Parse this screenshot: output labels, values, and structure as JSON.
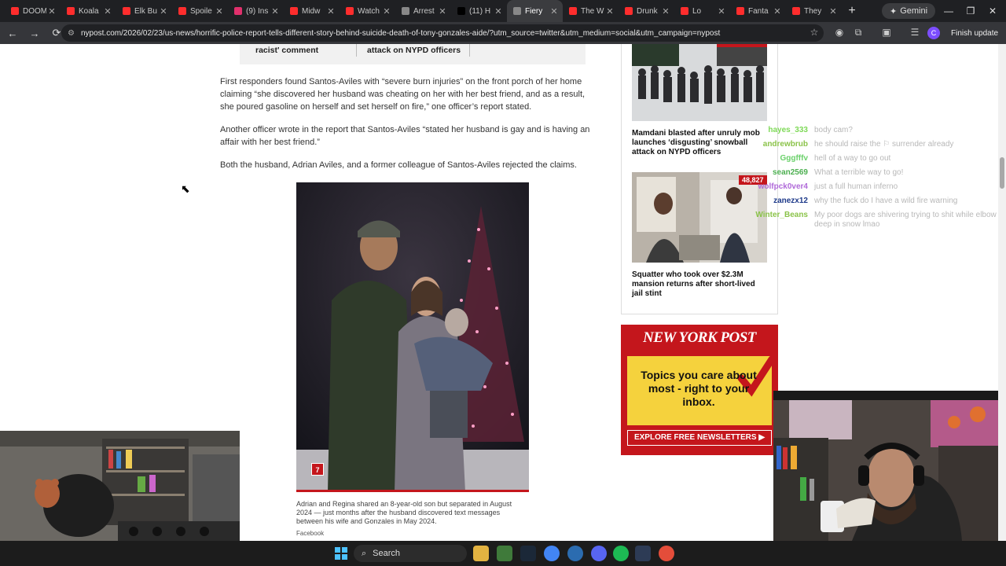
{
  "tabs": [
    {
      "label": "DOOM",
      "color": "#ff2d2d"
    },
    {
      "label": "Koala",
      "color": "#ff2d2d"
    },
    {
      "label": "Elk Bu",
      "color": "#ff2d2d"
    },
    {
      "label": "Spoile",
      "color": "#ff2d2d"
    },
    {
      "label": "(9) Ins",
      "color": "#e1306c"
    },
    {
      "label": "Midw",
      "color": "#ff2d2d"
    },
    {
      "label": "Watch",
      "color": "#ff2d2d"
    },
    {
      "label": "Arrest",
      "color": "#888888"
    },
    {
      "label": "(11) H",
      "color": "#000000"
    },
    {
      "label": "Fiery",
      "color": "#888888"
    },
    {
      "label": "The W",
      "color": "#ff2d2d"
    },
    {
      "label": "Drunk",
      "color": "#ff2d2d"
    },
    {
      "label": "Lo",
      "color": "#ff2d2d"
    },
    {
      "label": "Fanta",
      "color": "#ff2d2d"
    },
    {
      "label": "They",
      "color": "#ff2d2d"
    }
  ],
  "active_tab_index": 9,
  "new_tab_label": "+",
  "gemini_label": "Gemini",
  "window_controls": {
    "minimize": "—",
    "maximize": "❐",
    "close": "✕"
  },
  "toolbar": {
    "back": "←",
    "forward": "→",
    "reload": "⟳",
    "url": "nypost.com/2026/02/23/us-news/horrific-police-report-tells-different-story-behind-suicide-death-of-tony-gonzales-aide/?utm_source=twitter&utm_medium=social&utm_campaign=nypost",
    "finish_update": "Finish update"
  },
  "related": {
    "left": "racist' comment",
    "middle": "attack on NYPD officers"
  },
  "paragraphs": [
    "First responders found Santos-Aviles with “severe burn injuries” on the front porch of her home claiming “she discovered her husband was cheating on her with her best friend, and as a result, she poured gasoline on herself and set herself on fire,” one officer’s report stated.",
    "Another officer wrote in the report that Santos-Aviles “stated her husband is gay and is having an affair with her best friend.”",
    "Both the husband, Adrian Aviles, and a former colleague of Santos-Aviles rejected the claims."
  ],
  "photo": {
    "gallery_count": "7",
    "caption": "Adrian and Regina shared an 8-year-old son but separated in August 2024 — just months after the husband discovered text messages between his wife and Gonzales in May 2024.",
    "credit": "Facebook"
  },
  "sidebar": {
    "story1_title": "Mamdani blasted after unruly mob launches ‘disgusting’ snowball attack on NYPD officers",
    "story2_views": "48,827",
    "story2_title": "Squatter who took over $2.3M mansion returns after short-lived jail stint"
  },
  "ad": {
    "logo": "NEW YORK POST",
    "text": "Topics you care about most - right to your inbox.",
    "cta": "EXPLORE FREE NEWSLETTERS ▶"
  },
  "chat": [
    {
      "user": "hayes_333",
      "msg": "body cam?",
      "color": "#7ed957"
    },
    {
      "user": "andrewbrub",
      "msg": "he should raise the ⚐ surrender already",
      "color": "#8bc34a"
    },
    {
      "user": "Gggfffv",
      "msg": "hell of a way to go out",
      "color": "#6bd16b"
    },
    {
      "user": "sean2569",
      "msg": "What a terrible way to go!",
      "color": "#4caf50"
    },
    {
      "user": "wolfpck0ver4",
      "msg": "just a full human inferno",
      "color": "#b06ad9"
    },
    {
      "user": "zanezx12",
      "msg": "why the fuck do I have a wild fire warning",
      "color": "#1e3a8a"
    },
    {
      "user": "Winter_Beans",
      "msg": "My poor dogs are shivering trying to shit while elbow deep in snow lmao",
      "color": "#8bc34a"
    }
  ],
  "taskbar": {
    "search_label": "Search"
  }
}
